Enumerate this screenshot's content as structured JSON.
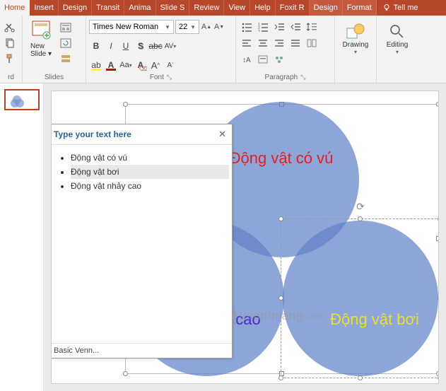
{
  "tabs": {
    "home": "Home",
    "insert": "Insert",
    "design": "Design",
    "transitions": "Transit",
    "animations": "Anima",
    "slideshow": "Slide S",
    "review": "Review",
    "view": "View",
    "help": "Help",
    "foxit": "Foxit R",
    "design2": "Design",
    "format": "Format",
    "tellme": "Tell me"
  },
  "ribbon": {
    "clipboard": {
      "label": "rd"
    },
    "slides": {
      "label": "Slides",
      "newslide": "New\nSlide"
    },
    "font": {
      "label": "Font",
      "name": "Times New Roman",
      "size": "22"
    },
    "paragraph": {
      "label": "Paragraph"
    },
    "drawing": {
      "label": "Drawing"
    },
    "editing": {
      "label": "Editing"
    }
  },
  "textpane": {
    "title": "Type your text here",
    "items": [
      "Động vật có vú",
      "Động vật bơi",
      "Động vật nhảy cao"
    ],
    "footer": "Basic Venn..."
  },
  "venn": {
    "c1": "Động vật có vú",
    "c2": "Động vật nhảy cao",
    "c3": "Động vật bơi"
  },
  "watermark": "uantrimang"
}
